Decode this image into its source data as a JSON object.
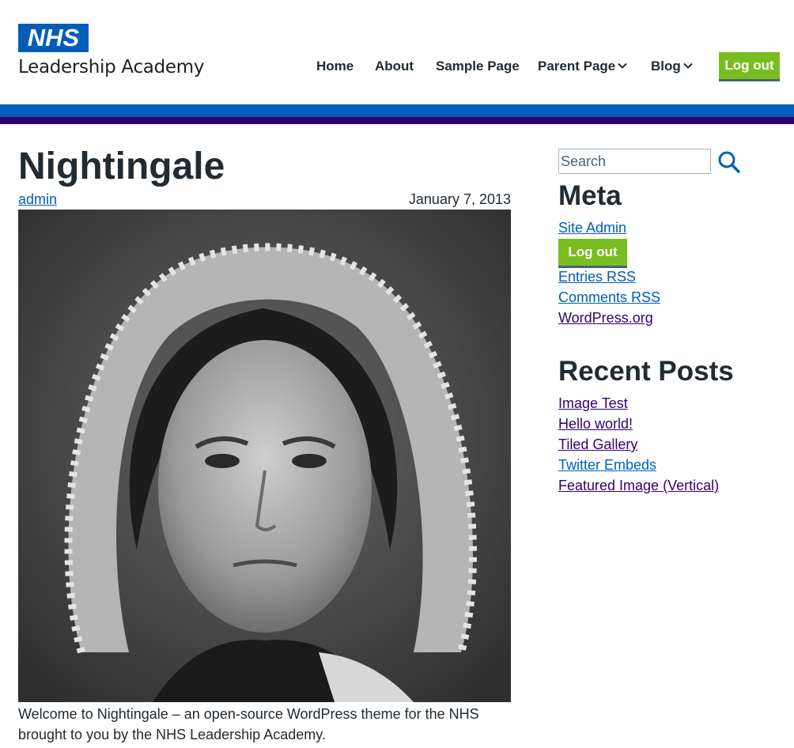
{
  "brand": {
    "nhs_logo_text": "NHS",
    "org_name": "Leadership Academy",
    "primary_color": "#005eb8",
    "secondary_color": "#330072",
    "button_color": "#78be20"
  },
  "nav": {
    "items": [
      {
        "label": "Home"
      },
      {
        "label": "About"
      },
      {
        "label": "Sample Page"
      },
      {
        "label": "Parent Page",
        "has_dropdown": true
      },
      {
        "label": "Blog",
        "has_dropdown": true
      }
    ],
    "logout_label": "Log out"
  },
  "post": {
    "title": "Nightingale",
    "author": "admin",
    "date": "January 7, 2013",
    "featured_image": "portrait photograph (black and white)",
    "excerpt": "Welcome to Nightingale – an open-source WordPress theme for the NHS brought to you by the NHS Leadership Academy."
  },
  "sidebar": {
    "search": {
      "placeholder": "Search",
      "icon": "search-icon"
    },
    "meta": {
      "title": "Meta",
      "links": [
        "Site Admin",
        "Entries RSS",
        "Comments RSS",
        "WordPress.org"
      ],
      "logout_label": "Log out"
    },
    "recent_posts": {
      "title": "Recent Posts",
      "links": [
        "Image Test",
        "Hello world!",
        "Tiled Gallery",
        "Twitter Embeds",
        "Featured Image (Vertical)"
      ]
    }
  }
}
